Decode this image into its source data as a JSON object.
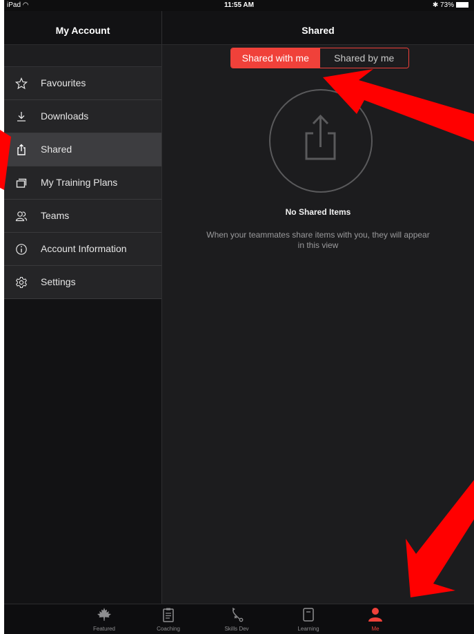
{
  "status_bar": {
    "device": "iPad",
    "time": "11:55 AM",
    "battery": "73%"
  },
  "sidebar": {
    "title": "My Account",
    "items": [
      {
        "label": "Favourites",
        "icon": "star-icon"
      },
      {
        "label": "Downloads",
        "icon": "download-icon"
      },
      {
        "label": "Shared",
        "icon": "share-icon",
        "active": true
      },
      {
        "label": "My Training Plans",
        "icon": "training-plans-icon"
      },
      {
        "label": "Teams",
        "icon": "teams-icon"
      },
      {
        "label": "Account Information",
        "icon": "info-icon"
      },
      {
        "label": "Settings",
        "icon": "gear-icon"
      }
    ]
  },
  "main": {
    "title": "Shared",
    "segments": [
      {
        "label": "Shared with me",
        "active": true
      },
      {
        "label": "Shared by me",
        "active": false
      }
    ],
    "empty_title": "No Shared Items",
    "empty_message": "When your teammates share items with you, they will appear in this view"
  },
  "tabbar": {
    "items": [
      {
        "label": "Featured",
        "icon": "maple-leaf-icon"
      },
      {
        "label": "Coaching",
        "icon": "clipboard-icon"
      },
      {
        "label": "Skills Dev",
        "icon": "skills-play-icon"
      },
      {
        "label": "Learning",
        "icon": "notebook-icon"
      },
      {
        "label": "Me",
        "icon": "person-icon",
        "active": true
      }
    ]
  },
  "colors": {
    "accent": "#f0413a",
    "background": "#1c1c1e",
    "sidebar": "#121214",
    "annotation_arrow": "#ff0000"
  }
}
